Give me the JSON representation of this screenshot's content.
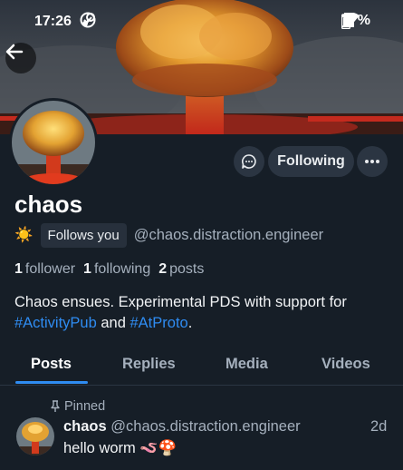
{
  "status_bar": {
    "time": "17:26",
    "battery": "77%",
    "icons": [
      "app-notification-icon",
      "steam-icon",
      "wifi-icon",
      "signal-icon",
      "battery-icon"
    ]
  },
  "profile": {
    "display_name": "chaos",
    "status_emoji": "☀️",
    "follows_you_label": "Follows you",
    "handle": "@chaos.distraction.engineer",
    "followers_count": "1",
    "followers_label": "follower",
    "following_count": "1",
    "following_label": "following",
    "posts_count": "2",
    "posts_label": "posts",
    "bio_text_1": "Chaos ensues. Experimental PDS with support for ",
    "bio_tag_1": "#ActivityPub",
    "bio_text_2": " and ",
    "bio_tag_2": "#AtProto",
    "bio_text_3": "."
  },
  "actions": {
    "following_label": "Following"
  },
  "tabs": [
    {
      "label": "Posts",
      "active": true
    },
    {
      "label": "Replies",
      "active": false
    },
    {
      "label": "Media",
      "active": false
    },
    {
      "label": "Videos",
      "active": false
    }
  ],
  "pinned_post": {
    "pinned_label": "Pinned",
    "author_name": "chaos",
    "author_handle": "@chaos.distraction.engineer",
    "time": "2d",
    "text": "hello worm 🪱🍄"
  },
  "colors": {
    "background": "#161e27",
    "accent": "#2f8cf2",
    "button_bg": "#2b3542",
    "muted_text": "#a5b0bd"
  }
}
